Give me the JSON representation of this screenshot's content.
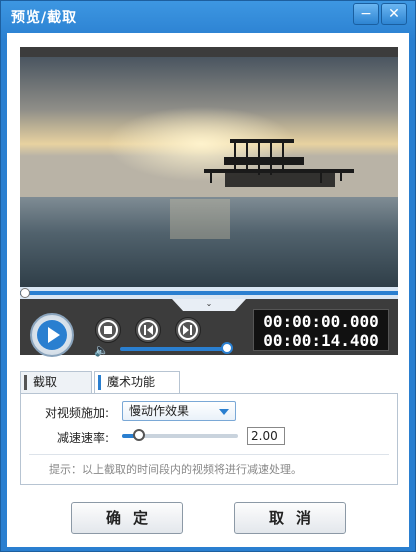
{
  "window": {
    "title": "预览/截取"
  },
  "player": {
    "current_time": "00:00:00.000",
    "total_time": "00:00:14.400",
    "progress": 0.0,
    "volume": 1.0
  },
  "tabs": [
    {
      "label": "截取",
      "active": false
    },
    {
      "label": "魔术功能",
      "active": true
    }
  ],
  "magic": {
    "apply_label": "对视频施加:",
    "effect_value": "慢动作效果",
    "rate_label": "减速速率:",
    "rate_value": "2.00",
    "rate_slider": 0.15,
    "hint": "提示：以上截取的时间段内的视频将进行减速处理。"
  },
  "buttons": {
    "ok": "确定",
    "cancel": "取消"
  },
  "colors": {
    "accent": "#2a7fd0",
    "title_bar": "#2f86d6"
  }
}
